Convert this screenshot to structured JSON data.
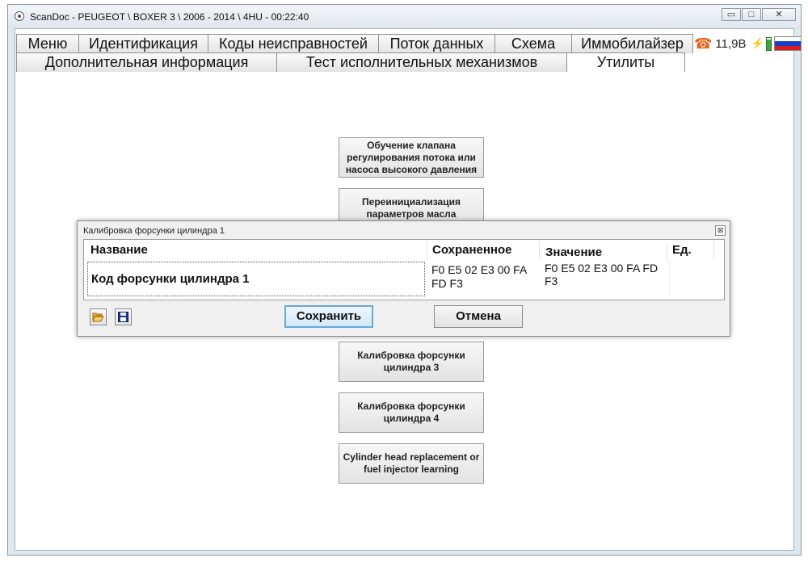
{
  "window": {
    "title": "ScanDoc - PEUGEOT \\ BOXER 3 \\ 2006 - 2014 \\ 4HU - 00:22:40",
    "controls": {
      "minimize": "▭",
      "maximize": "□",
      "close": "✕"
    }
  },
  "tabs_row1": [
    "Меню",
    "Идентификация",
    "Коды неисправностей",
    "Поток данных",
    "Схема",
    "Иммобилайзер"
  ],
  "tabs_row2": [
    "Дополнительная информация",
    "Тест исполнительных механизмов",
    "Утилиты"
  ],
  "active_tab": "Утилиты",
  "status": {
    "voltage": "11,9В",
    "phone_icon": "☎",
    "plug_icon": "⚡",
    "icons": [
      "phone-icon",
      "plug-icon",
      "battery-icon",
      "flag-icon"
    ],
    "phone_color": "#e4631a",
    "flag_colors": [
      "#ffffff",
      "#1a3ecb",
      "#d71d1d"
    ]
  },
  "utility_buttons": [
    "Обучение клапана регулирования потока или насоса высокого давления",
    "Переинициализация параметров масла",
    "Калибровка форсунки цилиндра 3",
    "Калибровка форсунки цилиндра 4",
    "Cylinder head replacement or fuel injector learning"
  ],
  "dialog": {
    "title": "Калибровка форсунки цилиндра 1",
    "close": "⊠",
    "columns": [
      "Название",
      "Сохраненное",
      "Значение",
      "Ед."
    ],
    "row": {
      "name": "Код форсунки цилиндра 1",
      "saved": "F0 E5 02 E3 00 FA FD F3",
      "value": "F0 E5 02 E3 00 FA FD F3",
      "unit": ""
    },
    "save_label": "Сохранить",
    "cancel_label": "Отмена",
    "icons": [
      "open-folder-icon",
      "save-disk-icon"
    ]
  }
}
